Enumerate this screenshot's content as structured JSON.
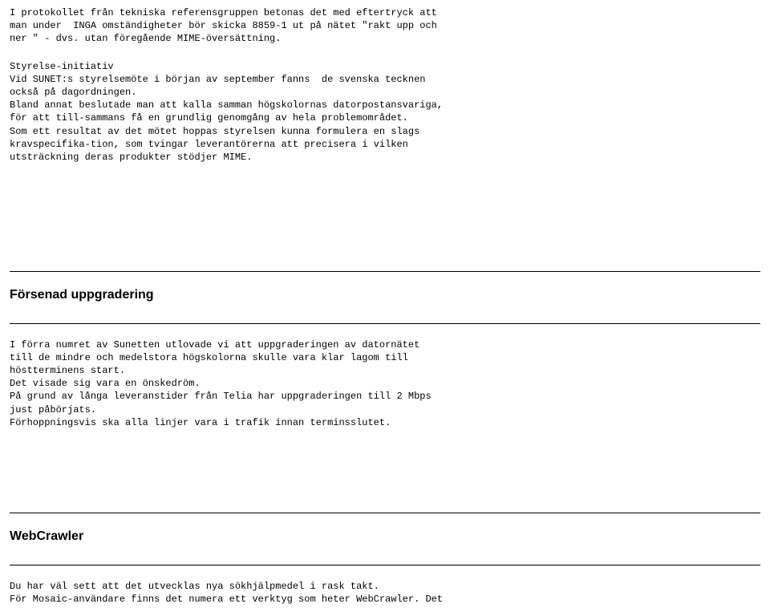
{
  "section1": {
    "para1": "I protokollet från tekniska referensgruppen betonas det med eftertryck att\nman under  INGA omständigheter bör skicka 8859-1 ut på nätet \"rakt upp och\nner \" - dvs. utan föregående MIME-översättning.",
    "para2": "Styrelse-initiativ\nVid SUNET:s styrelsemöte i början av september fanns  de svenska tecknen\nockså på dagordningen.\nBland annat beslutade man att kalla samman högskolornas datorpostansvariga,\nför att till-sammans få en grundlig genomgång av hela problemområdet.\nSom ett resultat av det mötet hoppas styrelsen kunna formulera en slags\nkravspecifika-tion, som tvingar leverantörerna att precisera i vilken\nutsträckning deras produkter stödjer MIME."
  },
  "section2": {
    "heading": "Försenad uppgradering",
    "body": "I förra numret av Sunetten utlovade vi att uppgraderingen av datornätet\ntill de mindre och medelstora högskolorna skulle vara klar lagom till\nhöstterminens start.\nDet visade sig vara en önskedröm.\nPå grund av långa leveranstider från Telia har uppgraderingen till 2 Mbps\njust påbörjats.\nFörhoppningsvis ska alla linjer vara i trafik innan terminsslutet."
  },
  "section3": {
    "heading": "WebCrawler",
    "body": "Du har väl sett att det utvecklas nya sökhjälpmedel i rask takt.\nFör Mosaic-användare finns det numera ett verktyg som heter WebCrawler. Det"
  }
}
